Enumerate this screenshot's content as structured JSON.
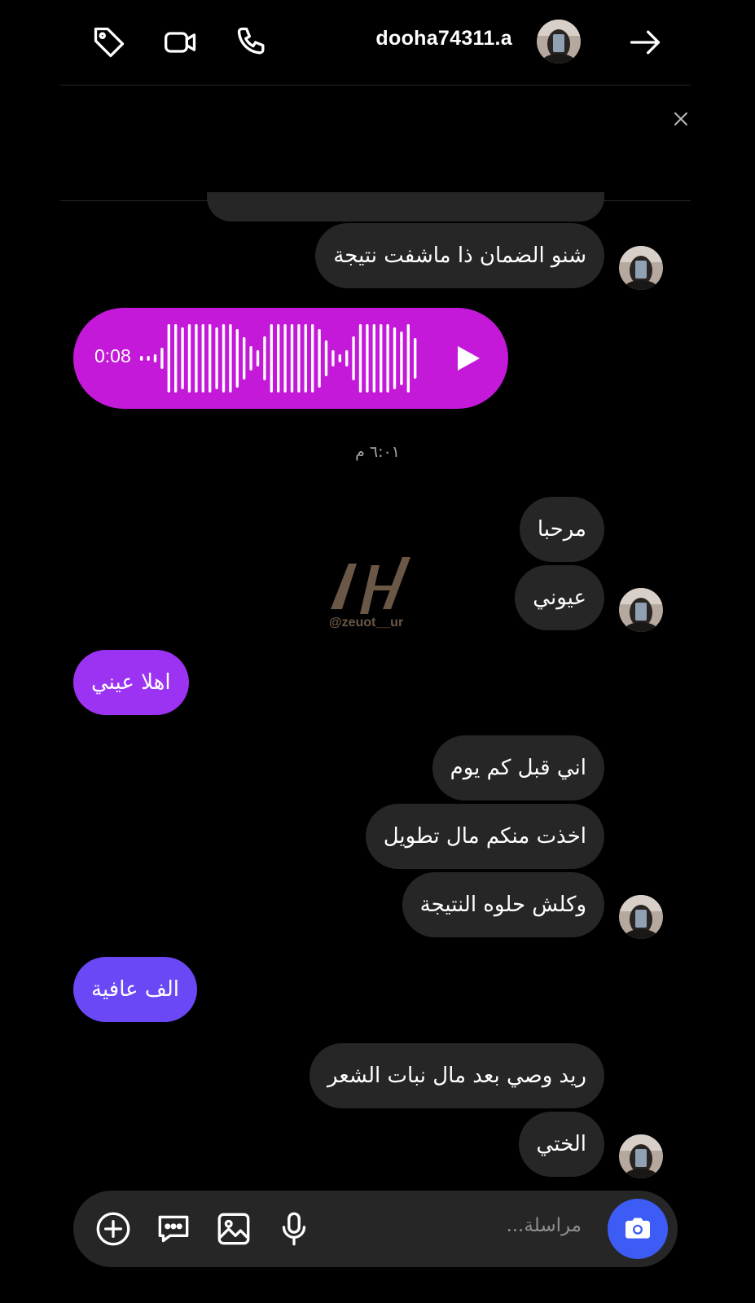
{
  "header": {
    "username": "dooha74311.a",
    "icons": [
      "tag-icon",
      "video-call-icon",
      "phone-icon",
      "arrow-right-icon"
    ]
  },
  "conversation": {
    "messages": [
      {
        "id": "m1",
        "from": "them",
        "text": "شنو الضمان ذا ماشفت نتيجة"
      },
      {
        "id": "m2",
        "from": "me",
        "type": "voice",
        "duration": "0:08"
      },
      {
        "id": "m3",
        "from": "them",
        "text": "مرحبا"
      },
      {
        "id": "m4",
        "from": "them",
        "text": "عيوني"
      },
      {
        "id": "m5",
        "from": "me",
        "text": "اهلا عيني"
      },
      {
        "id": "m6",
        "from": "them",
        "text": "اني قبل كم يوم"
      },
      {
        "id": "m7",
        "from": "them",
        "text": "اخذت منكم مال تطويل"
      },
      {
        "id": "m8",
        "from": "them",
        "text": "وكلش حلوه النتيجة"
      },
      {
        "id": "m9",
        "from": "me",
        "text": "الف عافية"
      },
      {
        "id": "m10",
        "from": "them",
        "text": "ريد وصي بعد مال نبات الشعر"
      },
      {
        "id": "m11",
        "from": "them",
        "text": "الختي"
      }
    ],
    "timestamp": "٦:٠١ م"
  },
  "watermark": {
    "handle": "@zeuot__ur"
  },
  "composer": {
    "placeholder": "مراسلة..."
  },
  "colors": {
    "incoming_bubble": "#262626",
    "voice_bubble": "#c419d9",
    "outgoing_purple": "#9c33f2",
    "outgoing_indigo": "#6a48f6",
    "camera_button": "#3d5cf5"
  }
}
